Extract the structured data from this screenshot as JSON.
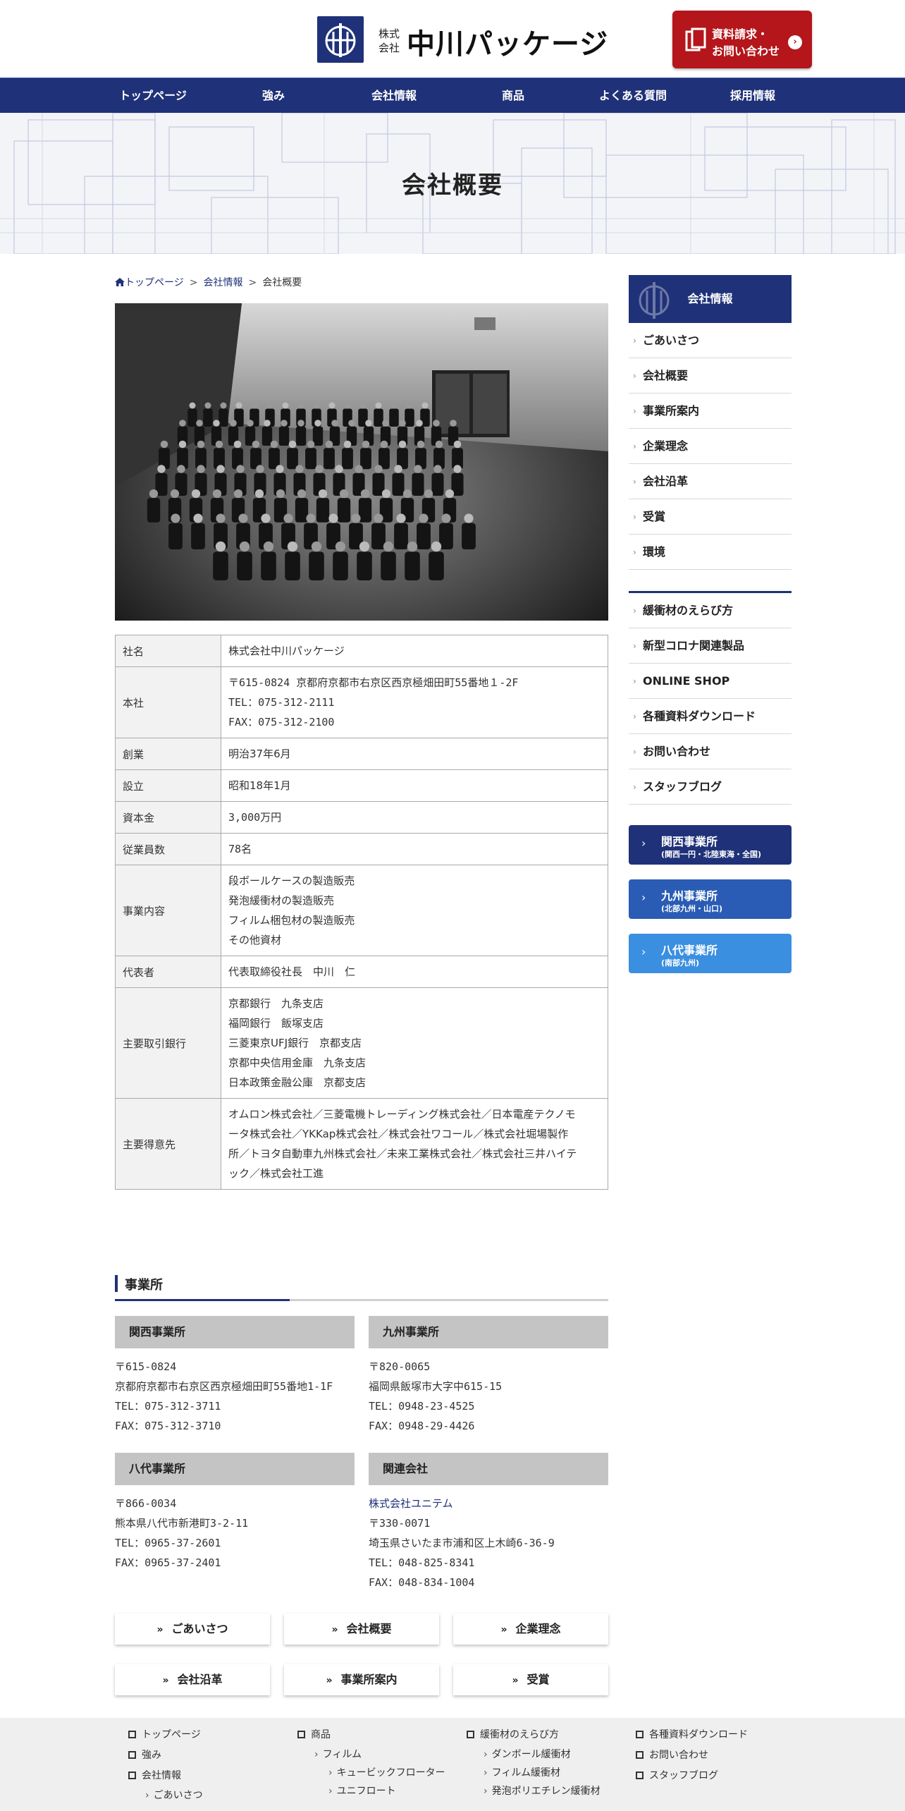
{
  "header": {
    "logo_kabu_line1": "株式",
    "logo_kabu_line2": "会社",
    "logo_name": "中川パッケージ",
    "cta_line1": "資料請求・",
    "cta_line2": "お問い合わせ"
  },
  "nav": [
    "トップページ",
    "強み",
    "会社情報",
    "商品",
    "よくある質問",
    "採用情報"
  ],
  "hero": {
    "title": "会社概要"
  },
  "breadcrumb": {
    "home": "トップページ",
    "parent": "会社情報",
    "current": "会社概要",
    "sep": ">"
  },
  "table": [
    {
      "label": "社名",
      "lines": [
        "株式会社中川パッケージ"
      ]
    },
    {
      "label": "本社",
      "lines": [
        "〒615-0824 京都府京都市右京区西京極畑田町55番地１-2F",
        "TEL：075-312-2111",
        "FAX：075-312-2100"
      ]
    },
    {
      "label": "創業",
      "lines": [
        "明治37年6月"
      ]
    },
    {
      "label": "設立",
      "lines": [
        "昭和18年1月"
      ]
    },
    {
      "label": "資本金",
      "lines": [
        "3,000万円"
      ]
    },
    {
      "label": "従業員数",
      "lines": [
        "78名"
      ]
    },
    {
      "label": "事業内容",
      "lines": [
        "段ボールケースの製造販売",
        "発泡緩衝材の製造販売",
        "フィルム梱包材の製造販売",
        "その他資材"
      ]
    },
    {
      "label": "代表者",
      "lines": [
        "代表取締役社長　中川　仁"
      ]
    },
    {
      "label": "主要取引銀行",
      "lines": [
        "京都銀行　九条支店",
        "福岡銀行　飯塚支店",
        "三菱東京UFJ銀行　京都支店",
        "京都中央信用金庫　九条支店",
        "日本政策金融公庫　京都支店"
      ]
    },
    {
      "label": "主要得意先",
      "lines": [
        "オムロン株式会社／三菱電機トレーディング株式会社／日本電産テクノモ",
        "ータ株式会社／YKKap株式会社／株式会社ワコール／株式会社堀場製作",
        "所／トヨタ自動車九州株式会社／未来工業株式会社／株式会社三井ハイテ",
        "ック／株式会社工進"
      ]
    }
  ],
  "offices_title": "事業所",
  "offices": [
    {
      "name": "関西事業所",
      "lines": [
        "〒615-0824",
        "京都府京都市右京区西京極畑田町55番地1-1F",
        "TEL：075-312-3711",
        "FAX：075-312-3710"
      ]
    },
    {
      "name": "九州事業所",
      "lines": [
        "〒820-0065",
        "福岡県飯塚市大字中615-15",
        "TEL：0948-23-4525",
        "FAX：0948-29-4426"
      ]
    },
    {
      "name": "八代事業所",
      "lines": [
        "〒866-0034",
        "熊本県八代市新港町3-2-11",
        "TEL：0965-37-2601",
        "FAX：0965-37-2401"
      ]
    },
    {
      "name": "関連会社",
      "link": "株式会社ユニテム",
      "lines": [
        "〒330-0071",
        "埼玉県さいたま市浦和区上木崎6-36-9",
        "TEL：048-825-8341",
        "FAX：048-834-1004"
      ]
    }
  ],
  "bottom_buttons": [
    "ごあいさつ",
    "会社概要",
    "企業理念",
    "会社沿革",
    "事業所案内",
    "受賞"
  ],
  "sidebar": {
    "head": "会社情報",
    "items1": [
      "ごあいさつ",
      "会社概要",
      "事業所案内",
      "企業理念",
      "会社沿革",
      "受賞",
      "環境"
    ],
    "items2": [
      "緩衝材のえらび方",
      "新型コロナ関連製品",
      "ONLINE SHOP",
      "各種資料ダウンロード",
      "お問い合わせ",
      "スタッフブログ"
    ],
    "offices": [
      {
        "name": "関西事業所",
        "sub": "(関西一円・北陸東海・全国)",
        "color": "#1f3178"
      },
      {
        "name": "九州事業所",
        "sub": "(北部九州・山口)",
        "color": "#2a5cb5"
      },
      {
        "name": "八代事業所",
        "sub": "(南部九州)",
        "color": "#3a8fe0"
      }
    ]
  },
  "footer": {
    "col1": [
      "トップページ",
      "強み",
      "会社情報"
    ],
    "col1_sub": [
      "ごあいさつ"
    ],
    "col2": [
      "商品"
    ],
    "col2_sub": [
      "フィルム"
    ],
    "col2_sub2": [
      "キュービックフローター",
      "ユニフロート"
    ],
    "col3": [
      "緩衝材のえらび方"
    ],
    "col3_sub": [
      "ダンボール緩衝材",
      "フィルム緩衝材",
      "発泡ポリエチレン緩衝材"
    ],
    "col4": [
      "各種資料ダウンロード",
      "お問い合わせ",
      "スタッフブログ"
    ]
  },
  "colors": {
    "brand": "#1f3178",
    "cta": "#b4161b"
  }
}
